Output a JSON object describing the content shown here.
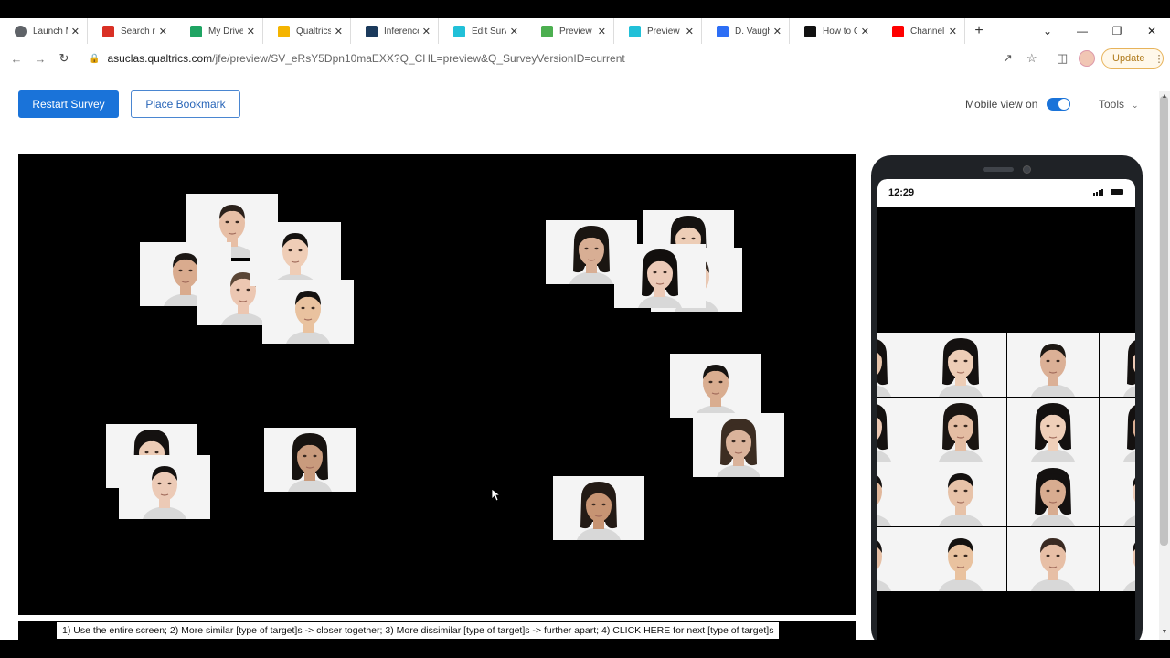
{
  "browser": {
    "tabs": [
      {
        "label": "Launch M",
        "icon": "globe-icon",
        "color": "#5f6368"
      },
      {
        "label": "Search re",
        "icon": "gmail-icon",
        "color": "#d93025"
      },
      {
        "label": "My Drive",
        "icon": "drive-icon",
        "color": "#1fa463"
      },
      {
        "label": "Qualtrics",
        "icon": "slides-icon",
        "color": "#f4b400"
      },
      {
        "label": "Inference",
        "icon": "doc-icon",
        "color": "#1b3a5c"
      },
      {
        "label": "Edit Surv",
        "icon": "xm-icon",
        "color": "#21c0d8"
      },
      {
        "label": "Preview",
        "icon": "dots-icon",
        "color": "#4caf50"
      },
      {
        "label": "Preview",
        "icon": "xm-icon",
        "color": "#21c0d8"
      },
      {
        "label": "D. Vaugh",
        "icon": "diamond-icon",
        "color": "#2d6ef5"
      },
      {
        "label": "How to C",
        "icon": "amazon-icon",
        "color": "#111111"
      },
      {
        "label": "Channel",
        "icon": "youtube-icon",
        "color": "#ff0000"
      }
    ],
    "new_tab": "+",
    "url_host": "asuclas.qualtrics.com",
    "url_path": "/jfe/preview/SV_eRsY5Dpn10maEXX?Q_CHL=preview&Q_SurveyVersionID=current",
    "update_label": "Update"
  },
  "toolbar": {
    "restart_label": "Restart Survey",
    "bookmark_label": "Place Bookmark",
    "mobile_view_label": "Mobile view on",
    "tools_label": "Tools",
    "accent": "#1a73d9"
  },
  "instructions": "1) Use the entire screen; 2) More similar [type of target]s -> closer together; 3) More dissimilar [type of target]s -> further apart; 4) CLICK HERE for next [type of target]s",
  "phone": {
    "time": "12:29"
  }
}
